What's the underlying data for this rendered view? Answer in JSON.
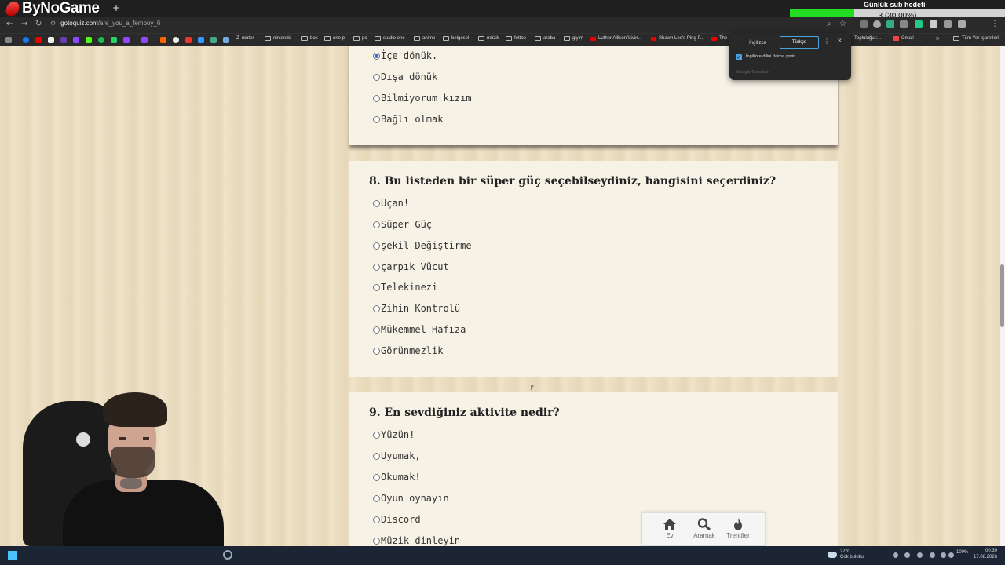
{
  "stream": {
    "logo_text": "ByNoGame",
    "goal_title": "Günlük sub hedefi",
    "goal_progress_text": "3 (30.00%)",
    "goal_progress_percent": 30,
    "goal_counter": "0",
    "colors": {
      "goal_fill": "#22dd22",
      "logo_red": "#e00000"
    }
  },
  "browser": {
    "new_tab": "+",
    "url_host": "gotoquiz.com",
    "url_path": "/are_you_a_femboy_6",
    "bookmarks": [
      "router",
      "nintendo",
      "box",
      "one p",
      "pc",
      "studio one",
      "anime",
      "belgesel",
      "müzik",
      "fottoo",
      "araba",
      "giyim",
      "Luther Allison\"Livin...",
      "Shawn Lee's Ping P...",
      "The",
      "Topluluğu :...",
      "Gmail",
      "Tüm Yer İşaretleri"
    ],
    "bookmarks_more": "»"
  },
  "translate_popup": {
    "lang_source": "İngilizce",
    "lang_target": "Türkçe",
    "always_translate": "İngilizce dilini daima çevir",
    "footer": "Google Translate",
    "more_icon": "⋮",
    "close_icon": "×"
  },
  "quiz": {
    "q7_options": [
      {
        "label": "İçe dönük.",
        "selected": true
      },
      {
        "label": "Dışa dönük",
        "selected": false
      },
      {
        "label": "Bilmiyorum kızım",
        "selected": false
      },
      {
        "label": "Bağlı olmak",
        "selected": false
      }
    ],
    "q8": {
      "title": "8. Bu listeden bir süper güç seçebilseydiniz, hangisini seçerdiniz?",
      "options": [
        "Uçan!",
        "Süper Güç",
        "şekil Değiştirme",
        "çarpık Vücut",
        "Telekinezi",
        "Zihin Kontrolü",
        "Mükemmel Hafıza",
        "Görünmezlik"
      ]
    },
    "q9": {
      "title": "9. En sevdiğiniz aktivite nedir?",
      "options": [
        "Yüzün!",
        "Uyumak,",
        "Okumak!",
        "Oyun oynayın",
        "Discord",
        "Müzik dinleyin"
      ]
    }
  },
  "bottom_nav": {
    "items": [
      {
        "label": "Ev",
        "icon": "home-icon"
      },
      {
        "label": "Aramak",
        "icon": "search-icon"
      },
      {
        "label": "Trendler",
        "icon": "flame-icon"
      }
    ]
  },
  "taskbar": {
    "weather_temp": "22°C",
    "weather_desc": "Çok bulutlu",
    "battery": "100%",
    "time": "00:39",
    "date": "17.08.2026"
  }
}
